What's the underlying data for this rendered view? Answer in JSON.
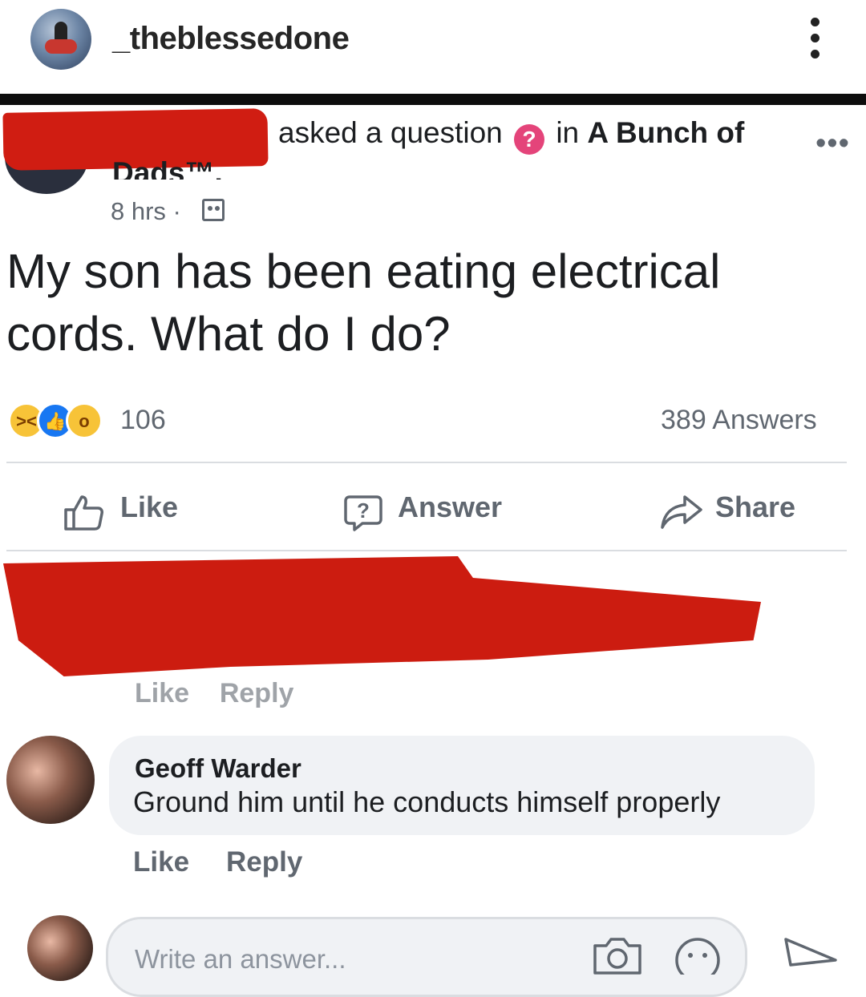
{
  "instagram": {
    "username": "_theblessedone",
    "more_icon": "vertical-ellipsis-icon"
  },
  "post": {
    "asked_text": "asked a question",
    "in_text": "in",
    "group_name_line1": "A Bunch of",
    "group_name_line2": "Dads™.",
    "time": "8 hrs",
    "separator": "·",
    "more_label": "•••",
    "question": "My son has been eating electrical cords. What do I do?",
    "reaction_count": "106",
    "answers_count": "389 Answers"
  },
  "actions": {
    "like": "Like",
    "answer": "Answer",
    "share": "Share"
  },
  "redacted_comment": {
    "like": "Like",
    "reply": "Reply"
  },
  "comment": {
    "author": "Geoff Warder",
    "text": "Ground him until he conducts himself properly",
    "like": "Like",
    "reply": "Reply"
  },
  "composer": {
    "placeholder": "Write an answer..."
  },
  "colors": {
    "redaction": "#d01d12",
    "question_badge": "#e4447a",
    "like_blue": "#1877f2",
    "muted_text": "#606770"
  }
}
